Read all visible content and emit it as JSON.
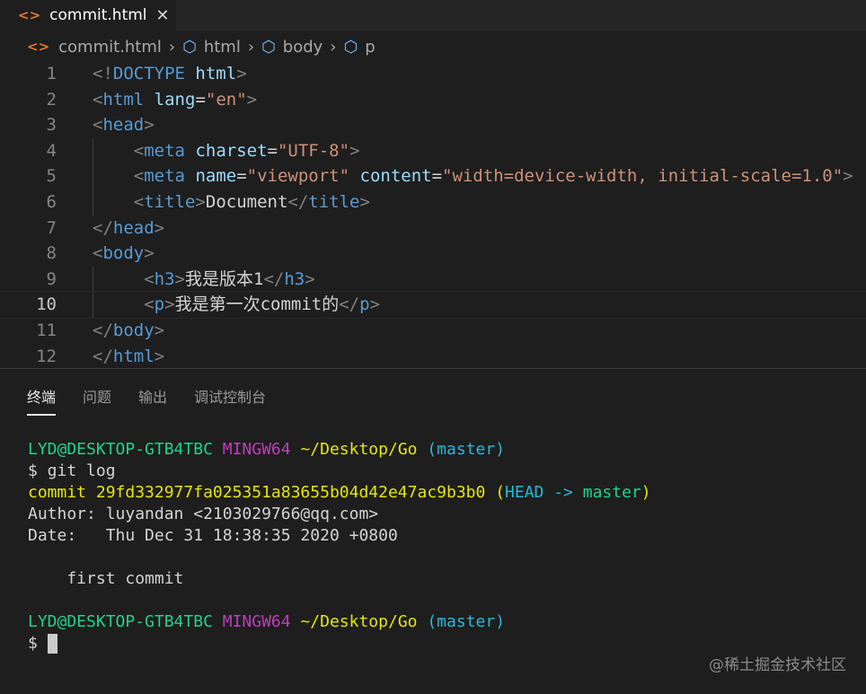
{
  "tab": {
    "icon": "<>",
    "label": "commit.html",
    "close": "✕"
  },
  "breadcrumb": [
    "commit.html",
    "html",
    "body",
    "p"
  ],
  "code": [
    [
      [
        "b",
        "<!"
      ],
      [
        "t",
        "DOCTYPE"
      ],
      [
        "x",
        " "
      ],
      [
        "a",
        "html"
      ],
      [
        "b",
        ">"
      ]
    ],
    [
      [
        "b",
        "<"
      ],
      [
        "t",
        "html"
      ],
      [
        "x",
        " "
      ],
      [
        "a",
        "lang"
      ],
      [
        "x",
        "="
      ],
      [
        "s",
        "\"en\""
      ],
      [
        "b",
        ">"
      ]
    ],
    [
      [
        "b",
        "<"
      ],
      [
        "t",
        "head"
      ],
      [
        "b",
        ">"
      ]
    ],
    [
      [
        "x",
        "    "
      ],
      [
        "b",
        "<"
      ],
      [
        "t",
        "meta"
      ],
      [
        "x",
        " "
      ],
      [
        "a",
        "charset"
      ],
      [
        "x",
        "="
      ],
      [
        "s",
        "\"UTF-8\""
      ],
      [
        "b",
        ">"
      ]
    ],
    [
      [
        "x",
        "    "
      ],
      [
        "b",
        "<"
      ],
      [
        "t",
        "meta"
      ],
      [
        "x",
        " "
      ],
      [
        "a",
        "name"
      ],
      [
        "x",
        "="
      ],
      [
        "s",
        "\"viewport\""
      ],
      [
        "x",
        " "
      ],
      [
        "a",
        "content"
      ],
      [
        "x",
        "="
      ],
      [
        "s",
        "\"width=device-width, initial-scale=1.0\""
      ],
      [
        "b",
        ">"
      ]
    ],
    [
      [
        "x",
        "    "
      ],
      [
        "b",
        "<"
      ],
      [
        "t",
        "title"
      ],
      [
        "b",
        ">"
      ],
      [
        "x",
        "Document"
      ],
      [
        "b",
        "</"
      ],
      [
        "t",
        "title"
      ],
      [
        "b",
        ">"
      ]
    ],
    [
      [
        "b",
        "</"
      ],
      [
        "t",
        "head"
      ],
      [
        "b",
        ">"
      ]
    ],
    [
      [
        "b",
        "<"
      ],
      [
        "t",
        "body"
      ],
      [
        "b",
        ">"
      ]
    ],
    [
      [
        "x",
        "     "
      ],
      [
        "b",
        "<"
      ],
      [
        "t",
        "h3"
      ],
      [
        "b",
        ">"
      ],
      [
        "x",
        "我是版本1"
      ],
      [
        "b",
        "</"
      ],
      [
        "t",
        "h3"
      ],
      [
        "b",
        ">"
      ]
    ],
    [
      [
        "x",
        "     "
      ],
      [
        "b",
        "<"
      ],
      [
        "t",
        "p"
      ],
      [
        "b",
        ">"
      ],
      [
        "x",
        "我是第一次commit的"
      ],
      [
        "b",
        "</"
      ],
      [
        "t",
        "p"
      ],
      [
        "b",
        ">"
      ]
    ],
    [
      [
        "b",
        "</"
      ],
      [
        "t",
        "body"
      ],
      [
        "b",
        ">"
      ]
    ],
    [
      [
        "b",
        "</"
      ],
      [
        "t",
        "html"
      ],
      [
        "b",
        ">"
      ]
    ]
  ],
  "active_line": 10,
  "panel_tabs": [
    "终端",
    "问题",
    "输出",
    "调试控制台"
  ],
  "terminal": [
    [
      [
        "g",
        "LYD@DESKTOP-GTB4TBC"
      ],
      [
        "x",
        " "
      ],
      [
        "m",
        "MINGW64"
      ],
      [
        "x",
        " "
      ],
      [
        "y",
        "~/Desktop/Go"
      ],
      [
        "x",
        " "
      ],
      [
        "c",
        "(master)"
      ]
    ],
    [
      [
        "x",
        "$ git log"
      ]
    ],
    [
      [
        "y",
        "commit 29fd332977fa025351a83655b04d42e47ac9b3b0"
      ],
      [
        "x",
        " "
      ],
      [
        "y",
        "("
      ],
      [
        "c",
        "HEAD -> "
      ],
      [
        "g",
        "master"
      ],
      [
        "y",
        ")"
      ]
    ],
    [
      [
        "x",
        "Author: luyandan <2103029766@qq.com>"
      ]
    ],
    [
      [
        "x",
        "Date:   Thu Dec 31 18:38:35 2020 +0800"
      ]
    ],
    [
      [
        "x",
        ""
      ]
    ],
    [
      [
        "x",
        "    first commit"
      ]
    ],
    [
      [
        "x",
        ""
      ]
    ],
    [
      [
        "g",
        "LYD@DESKTOP-GTB4TBC"
      ],
      [
        "x",
        " "
      ],
      [
        "m",
        "MINGW64"
      ],
      [
        "x",
        " "
      ],
      [
        "y",
        "~/Desktop/Go"
      ],
      [
        "x",
        " "
      ],
      [
        "c",
        "(master)"
      ]
    ],
    [
      [
        "x",
        "$ "
      ]
    ]
  ],
  "watermark": "@稀土掘金技术社区"
}
